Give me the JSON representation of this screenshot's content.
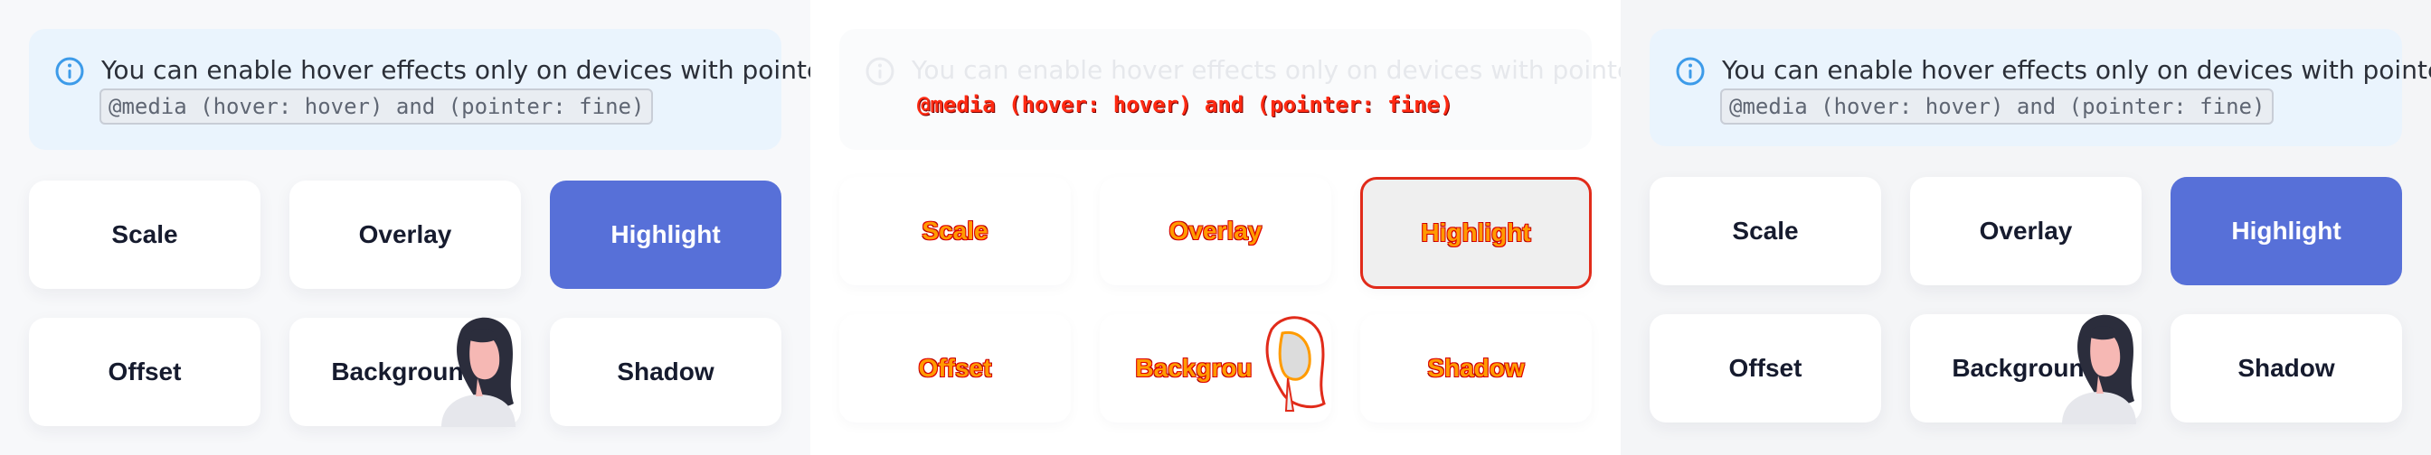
{
  "info": {
    "message": "You can enable hover effects only on devices with pointer:",
    "code": "@media (hover: hover) and (pointer: fine)"
  },
  "buttons": [
    {
      "label": "Scale"
    },
    {
      "label": "Overlay"
    },
    {
      "label": "Highlight"
    },
    {
      "label": "Offset"
    },
    {
      "label": "Background"
    },
    {
      "label": "Shadow"
    }
  ],
  "buttons_truncated": {
    "background_visible": "Backgrou"
  },
  "colors": {
    "accent": "#5770d8",
    "info_bg": "#eaf4fd",
    "info_icon": "#3d9be9",
    "text": "#161b2e",
    "diff_red": "#e12b1a",
    "diff_orange": "#ff9b00"
  },
  "icons": [
    "info-icon",
    "person-illustration"
  ]
}
